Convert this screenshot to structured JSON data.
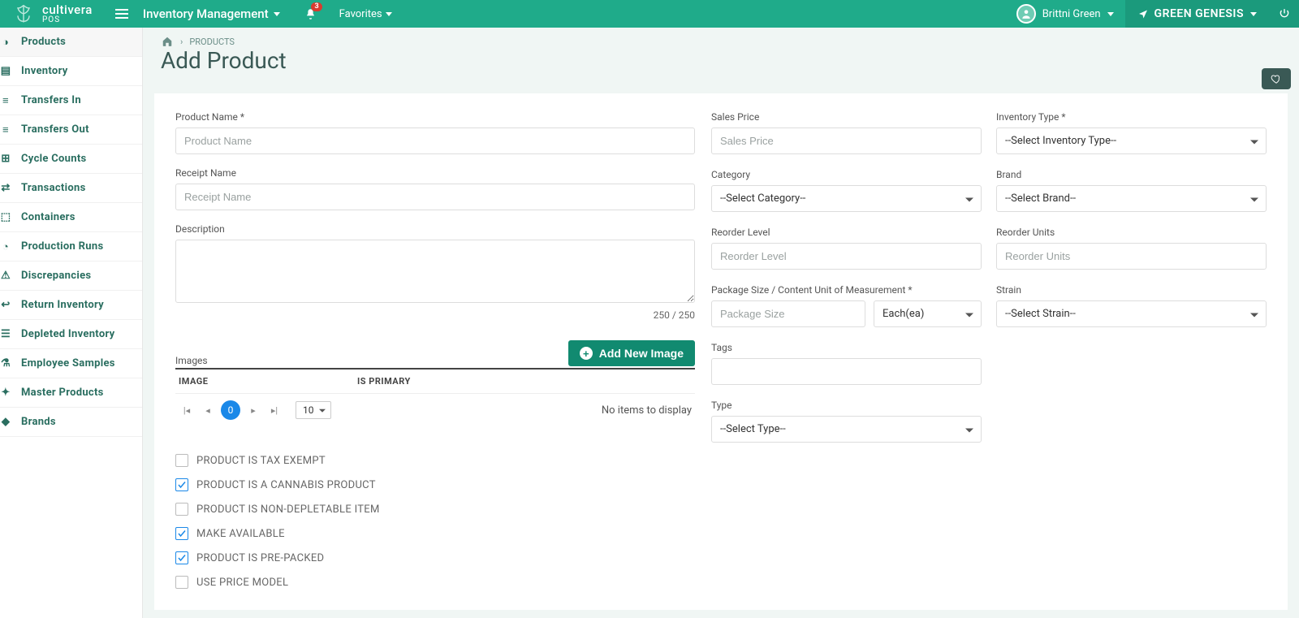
{
  "brand": {
    "name": "cultivera",
    "sub": "POS"
  },
  "topnav": {
    "menu": "Inventory Management",
    "notif_count": "3",
    "favorites": "Favorites",
    "user": "Brittni Green",
    "org": "GREEN GENESIS"
  },
  "sidebar": {
    "items": [
      {
        "label": "Products"
      },
      {
        "label": "Inventory"
      },
      {
        "label": "Transfers In"
      },
      {
        "label": "Transfers Out"
      },
      {
        "label": "Cycle Counts"
      },
      {
        "label": "Transactions"
      },
      {
        "label": "Containers"
      },
      {
        "label": "Production Runs"
      },
      {
        "label": "Discrepancies"
      },
      {
        "label": "Return Inventory"
      },
      {
        "label": "Depleted Inventory"
      },
      {
        "label": "Employee Samples"
      },
      {
        "label": "Master Products"
      },
      {
        "label": "Brands"
      }
    ]
  },
  "breadcrumb": {
    "sep": "›",
    "parent": "PRODUCTS"
  },
  "page": {
    "title": "Add Product"
  },
  "form": {
    "product_name_label": "Product Name *",
    "product_name_ph": "Product Name",
    "receipt_name_label": "Receipt Name",
    "receipt_name_ph": "Receipt Name",
    "description_label": "Description",
    "char_counter": "250 / 250",
    "images_label": "Images",
    "add_image_btn": "Add New Image",
    "grid": {
      "col_image": "IMAGE",
      "col_primary": "IS PRIMARY",
      "no_items": "No items to display",
      "page": "0",
      "page_size": "10"
    },
    "checks": [
      {
        "label": "PRODUCT IS TAX EXEMPT",
        "checked": false
      },
      {
        "label": "PRODUCT IS A CANNABIS PRODUCT",
        "checked": true
      },
      {
        "label": "PRODUCT IS NON-DEPLETABLE ITEM",
        "checked": false
      },
      {
        "label": "MAKE AVAILABLE",
        "checked": true
      },
      {
        "label": "PRODUCT IS PRE-PACKED",
        "checked": true
      },
      {
        "label": "USE PRICE MODEL",
        "checked": false
      }
    ]
  },
  "right": {
    "sales_price_label": "Sales Price",
    "sales_price_ph": "Sales Price",
    "inventory_type_label": "Inventory Type *",
    "inventory_type_value": "--Select Inventory Type--",
    "category_label": "Category",
    "category_value": "--Select Category--",
    "brand_label": "Brand",
    "brand_value": "--Select Brand--",
    "reorder_level_label": "Reorder Level",
    "reorder_level_ph": "Reorder Level",
    "reorder_units_label": "Reorder Units",
    "reorder_units_ph": "Reorder Units",
    "package_label": "Package Size / Content Unit of Measurement *",
    "package_ph": "Package Size",
    "package_unit": "Each(ea)",
    "strain_label": "Strain",
    "strain_value": "--Select Strain--",
    "tags_label": "Tags",
    "type_label": "Type",
    "type_value": "--Select Type--"
  }
}
